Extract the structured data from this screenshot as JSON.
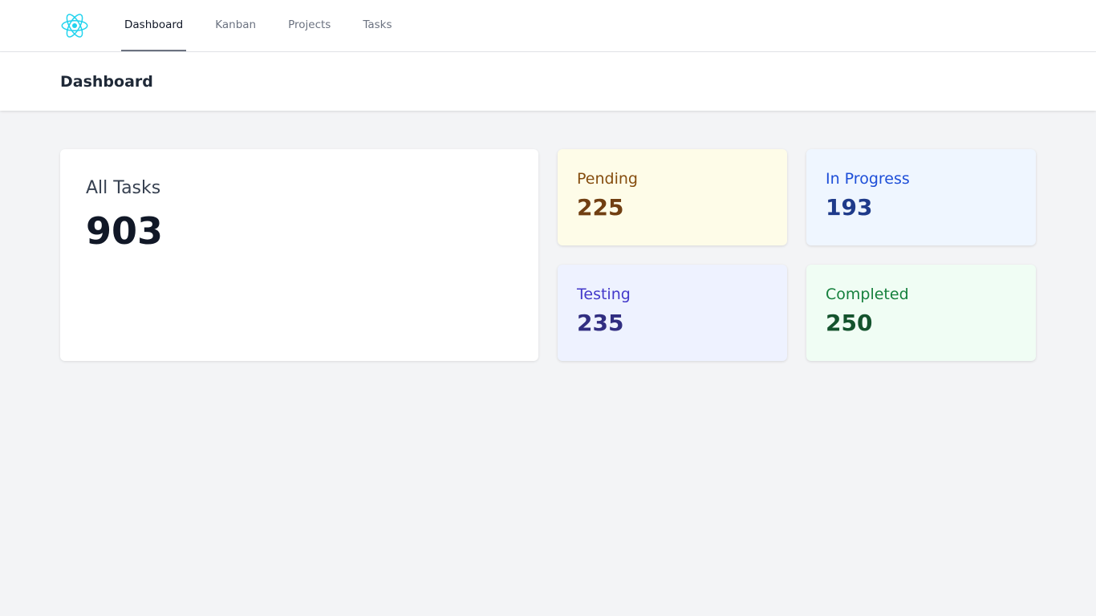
{
  "nav": {
    "logo_icon": "react-atom-icon",
    "links": [
      {
        "label": "Dashboard",
        "active": true
      },
      {
        "label": "Kanban",
        "active": false
      },
      {
        "label": "Projects",
        "active": false
      },
      {
        "label": "Tasks",
        "active": false
      }
    ]
  },
  "header": {
    "title": "Dashboard"
  },
  "summary": {
    "all_tasks": {
      "label": "All Tasks",
      "value": "903"
    },
    "stats": [
      {
        "key": "pending",
        "label": "Pending",
        "value": "225",
        "bg": "#fefce8",
        "color": "#854d0e"
      },
      {
        "key": "in_progress",
        "label": "In Progress",
        "value": "193",
        "bg": "#eff6ff",
        "color": "#1d4ed8"
      },
      {
        "key": "testing",
        "label": "Testing",
        "value": "235",
        "bg": "#eef2ff",
        "color": "#4338ca"
      },
      {
        "key": "completed",
        "label": "Completed",
        "value": "250",
        "bg": "#f0fdf4",
        "color": "#15803d"
      }
    ]
  }
}
